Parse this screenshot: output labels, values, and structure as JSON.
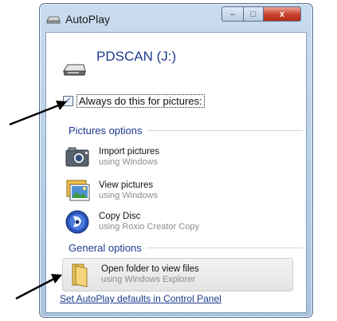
{
  "window": {
    "title": "AutoPlay",
    "controls": {
      "minimize": "–",
      "maximize": "□",
      "close": "x"
    }
  },
  "drive": {
    "title": "PDSCAN (J:)",
    "icon": "removable-drive-icon"
  },
  "always": {
    "label": "Always do this for pictures:",
    "checked": true
  },
  "pictures_options": {
    "header": "Pictures options",
    "items": [
      {
        "title": "Import pictures",
        "subtitle": "using Windows",
        "icon": "camera-icon"
      },
      {
        "title": "View pictures",
        "subtitle": "using Windows",
        "icon": "photo-gallery-icon"
      },
      {
        "title": "Copy Disc",
        "subtitle": "using Roxio Creator Copy",
        "icon": "roxio-disc-icon"
      }
    ]
  },
  "general_options": {
    "header": "General options",
    "items": [
      {
        "title": "Open folder to view files",
        "subtitle": "using Windows Explorer",
        "icon": "folder-icon"
      }
    ]
  },
  "footer": {
    "link": "Set AutoPlay defaults in Control Panel"
  },
  "colors": {
    "accent": "#1c3a8c",
    "close_button": "#c8412c",
    "frame": "#a9c3df"
  }
}
